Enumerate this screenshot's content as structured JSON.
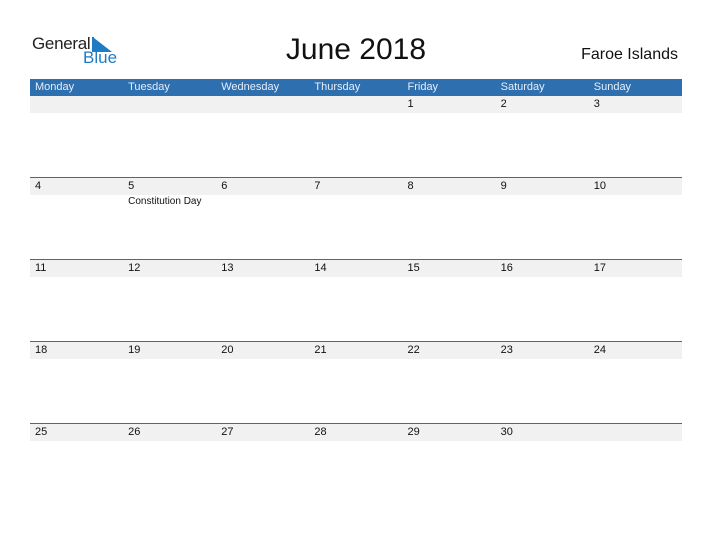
{
  "logo": {
    "word1": "General",
    "word2": "Blue",
    "brand_color": "#1f7bc4",
    "icon": "triangle-flag-icon"
  },
  "title": "June 2018",
  "region": "Faroe Islands",
  "header_color": "#2e6fb0",
  "weekdays": [
    "Monday",
    "Tuesday",
    "Wednesday",
    "Thursday",
    "Friday",
    "Saturday",
    "Sunday"
  ],
  "weeks": [
    {
      "days": [
        {
          "date": ""
        },
        {
          "date": ""
        },
        {
          "date": ""
        },
        {
          "date": ""
        },
        {
          "date": "1"
        },
        {
          "date": "2"
        },
        {
          "date": "3"
        }
      ]
    },
    {
      "days": [
        {
          "date": "4"
        },
        {
          "date": "5",
          "holiday": "Constitution Day"
        },
        {
          "date": "6"
        },
        {
          "date": "7"
        },
        {
          "date": "8"
        },
        {
          "date": "9"
        },
        {
          "date": "10"
        }
      ]
    },
    {
      "days": [
        {
          "date": "11"
        },
        {
          "date": "12"
        },
        {
          "date": "13"
        },
        {
          "date": "14"
        },
        {
          "date": "15"
        },
        {
          "date": "16"
        },
        {
          "date": "17"
        }
      ]
    },
    {
      "days": [
        {
          "date": "18"
        },
        {
          "date": "19"
        },
        {
          "date": "20"
        },
        {
          "date": "21"
        },
        {
          "date": "22"
        },
        {
          "date": "23"
        },
        {
          "date": "24"
        }
      ]
    },
    {
      "days": [
        {
          "date": "25"
        },
        {
          "date": "26"
        },
        {
          "date": "27"
        },
        {
          "date": "28"
        },
        {
          "date": "29"
        },
        {
          "date": "30"
        },
        {
          "date": ""
        }
      ]
    }
  ]
}
